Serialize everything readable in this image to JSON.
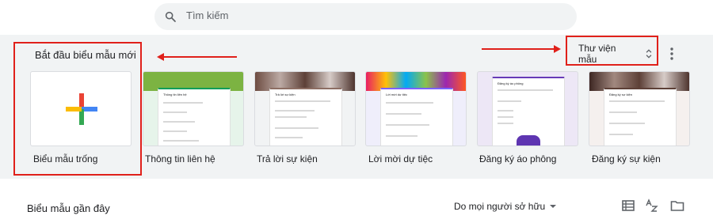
{
  "search": {
    "placeholder": "Tìm kiếm"
  },
  "gallery": {
    "title": "Bắt đầu biểu mẫu mới",
    "template_library_label": "Thư viện mẫu",
    "templates": [
      {
        "label": "Biểu mẫu trống",
        "type": "blank"
      },
      {
        "label": "Thông tin liên hệ",
        "type": "contact",
        "thumb_title": "Thông tin liên hệ",
        "accent": "#0f9d58",
        "bg": "#e6f4ea"
      },
      {
        "label": "Trả lời sự kiện",
        "type": "rsvp",
        "thumb_title": "Trả lời sự kiện",
        "accent": "#8d6e63",
        "bg": "#f1f3f4"
      },
      {
        "label": "Lời mời dự tiệc",
        "type": "party",
        "thumb_title": "Lời mời dự tiệc",
        "accent": "#7b61ff",
        "bg": "#efeefb"
      },
      {
        "label": "Đăng ký áo phông",
        "type": "tshirt",
        "thumb_title": "Đăng ký áo phông",
        "accent": "#673ab7",
        "bg": "#ede7f6"
      },
      {
        "label": "Đăng ký sự kiện",
        "type": "event",
        "thumb_title": "Đăng ký sự kiện",
        "accent": "#5d4037",
        "bg": "#f5f0ee"
      }
    ]
  },
  "recent": {
    "title": "Biểu mẫu gần đây",
    "owner_filter": "Do mọi người sở hữu"
  },
  "colors": {
    "annotation_red": "#e0201a",
    "gallery_bg": "#f1f3f4"
  }
}
